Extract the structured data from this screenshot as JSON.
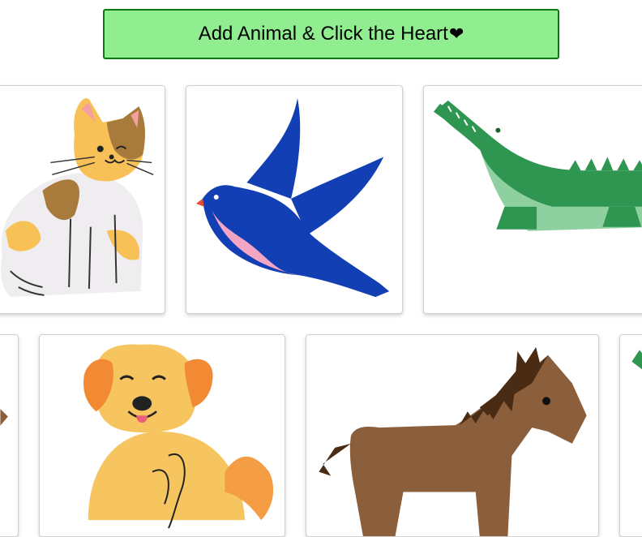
{
  "add_button": {
    "label": "Add Animal & Click the Heart",
    "heart": "❤"
  },
  "colors": {
    "button_bg": "#90ee90",
    "button_border": "#0a7a0a",
    "heart": "#e53935"
  },
  "cards": [
    {
      "animal": "cat",
      "icon": "cat-illustration",
      "heart_icon": "heart-icon"
    },
    {
      "animal": "bird",
      "icon": "bird-illustration",
      "heart_icon": "heart-icon"
    },
    {
      "animal": "crocodile",
      "icon": "crocodile-illustration"
    },
    {
      "animal": "unknown",
      "icon": "animal-illustration"
    },
    {
      "animal": "dog",
      "icon": "dog-illustration"
    },
    {
      "animal": "horse",
      "icon": "horse-illustration"
    },
    {
      "animal": "crocodile",
      "icon": "crocodile-illustration"
    }
  ]
}
